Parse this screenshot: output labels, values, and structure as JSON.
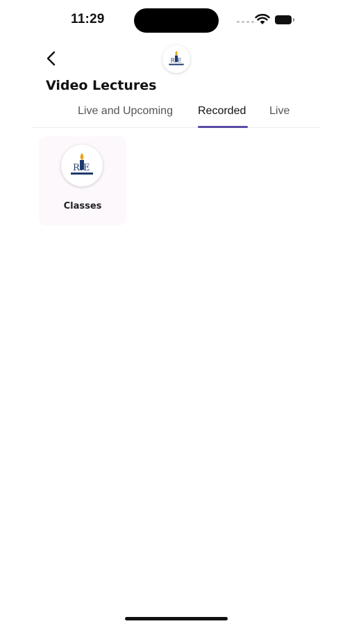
{
  "status_bar": {
    "time": "11:29",
    "icons": [
      "signal-icon",
      "wifi-icon",
      "battery-icon"
    ]
  },
  "header": {
    "back_icon": "chevron-left-icon",
    "logo_text": "RIE",
    "title": "Video Lectures"
  },
  "tabs": [
    {
      "label": "Live and Upcoming",
      "active": false
    },
    {
      "label": "Recorded",
      "active": true
    },
    {
      "label": "Live",
      "active": false
    }
  ],
  "classes": [
    {
      "label": "Classes",
      "logo_text": "RIE"
    }
  ],
  "colors": {
    "accent": "#5b4aa5",
    "card_background": "#fdf8fc",
    "logo_navy": "#1f3b6e",
    "logo_flame": "#e8a317"
  }
}
